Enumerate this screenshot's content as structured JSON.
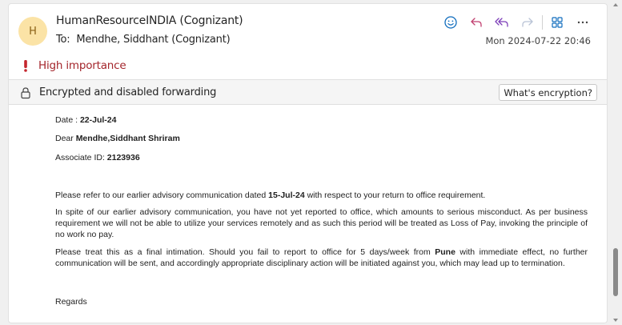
{
  "header": {
    "avatar_initial": "H",
    "sender": "HumanResourceINDIA (Cognizant)",
    "to_label": "To:",
    "recipient": "Mendhe, Siddhant (Cognizant)",
    "date": "Mon 2024-07-22 20:46"
  },
  "actions": [
    {
      "name": "emoji-reaction-icon"
    },
    {
      "name": "reply-icon"
    },
    {
      "name": "reply-all-icon"
    },
    {
      "name": "forward-icon"
    },
    {
      "name": "apps-icon"
    },
    {
      "name": "more-options-icon"
    }
  ],
  "importance": {
    "label": "High importance"
  },
  "banner": {
    "text": "Encrypted and disabled forwarding",
    "button_label": "What's encryption?"
  },
  "body": {
    "date_label": "Date : ",
    "date_value": "22-Jul-24",
    "dear_label": "Dear ",
    "dear_name": "Mendhe,Siddhant Shriram",
    "associate_label": "Associate ID: ",
    "associate_id": "2123936",
    "para1_start": "Please refer to our earlier advisory communication dated ",
    "para1_date": "15-Jul-24",
    "para1_end": " with respect to your return to office requirement.",
    "para2": "In spite of our earlier advisory communication, you have not yet reported to office, which amounts to serious misconduct. As per business requirement we will not be able to utilize your services remotely and as such this period will be treated as Loss of Pay, invoking the principle of no work no pay.",
    "para3_start": "Please treat this as a final intimation. Should you fail to report to office for 5 days/week from ",
    "para3_location": "Pune",
    "para3_end": " with immediate effect, no further communication will be sent, and accordingly appropriate disciplinary action will be initiated against you, which may lead up to termination.",
    "regards": "Regards"
  },
  "colors": {
    "accent": "#0f6cbd",
    "importance": "#a4262c",
    "avatar_bg": "#fbe3a6"
  }
}
